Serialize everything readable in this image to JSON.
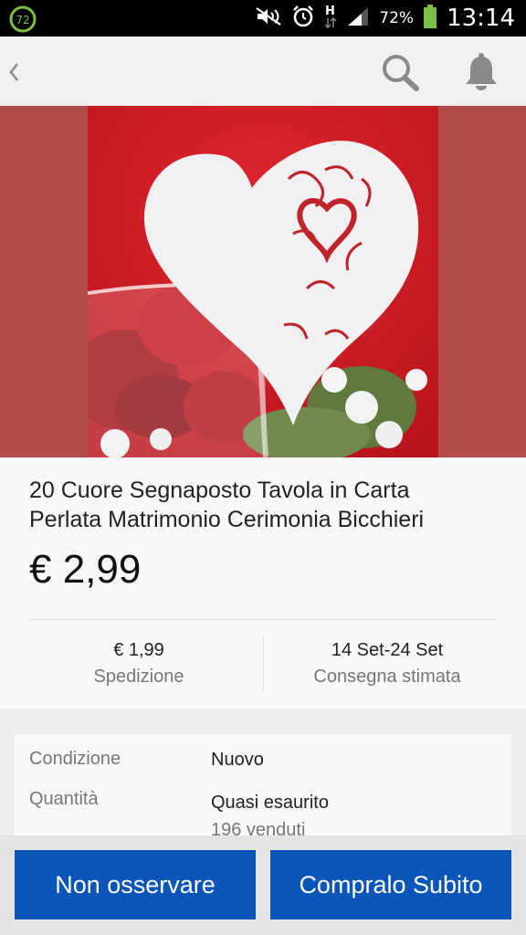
{
  "status_bar": {
    "notification_badge": "72",
    "battery_percent": "72%",
    "time": "13:14"
  },
  "app_bar": {
    "icons": [
      "back-chevron-icon",
      "search-icon",
      "bell-icon"
    ]
  },
  "colors": {
    "primary_button": "#0a55b8",
    "gallery_background": "#b34a4a"
  },
  "product": {
    "title_line1": "20 Cuore Segnaposto Tavola in Carta",
    "title_line2": "Perlata Matrimonio Cerimonia Bicchieri",
    "price": "€ 2,99",
    "shipping_value": "€ 1,99",
    "shipping_label": "Spedizione",
    "delivery_value": "14 Set-24 Set",
    "delivery_label": "Consegna stimata"
  },
  "details": {
    "condition_label": "Condizione",
    "condition_value": "Nuovo",
    "quantity_label": "Quantità",
    "quantity_value": "Quasi esaurito",
    "sold_text": "196 venduti"
  },
  "actions": {
    "unwatch_label": "Non osservare",
    "buy_now_label": "Compralo Subito"
  }
}
